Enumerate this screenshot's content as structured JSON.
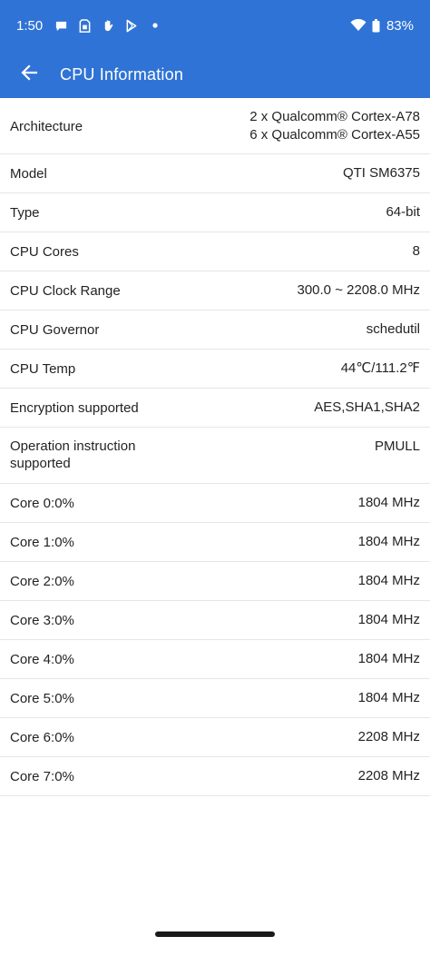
{
  "status_bar": {
    "time": "1:50",
    "battery": "83%",
    "icons": [
      "chat-bubble-icon",
      "sim-card-icon",
      "hand-icon",
      "play-store-icon",
      "dot-icon"
    ]
  },
  "toolbar": {
    "title": "CPU Information",
    "back_icon": "arrow-back-icon"
  },
  "colors": {
    "appbar": "#2f73d6",
    "divider": "#e6e6e6"
  },
  "rows": [
    {
      "label": "Architecture",
      "value_lines": [
        "2 x Qualcomm® Cortex-A78",
        "6 x Qualcomm® Cortex-A55"
      ]
    },
    {
      "label": "Model",
      "value": "QTI SM6375"
    },
    {
      "label": "Type",
      "value": "64-bit"
    },
    {
      "label": "CPU Cores",
      "value": "8"
    },
    {
      "label": "CPU Clock Range",
      "value": "300.0 ~ 2208.0 MHz"
    },
    {
      "label": "CPU Governor",
      "value": "schedutil"
    },
    {
      "label": "CPU Temp",
      "value": "44℃/111.2℉"
    },
    {
      "label": "Encryption supported",
      "value": "AES,SHA1,SHA2"
    },
    {
      "label_lines": [
        "Operation instruction",
        "supported"
      ],
      "value": "PMULL"
    },
    {
      "label": "Core 0:0%",
      "value": "1804 MHz"
    },
    {
      "label": "Core 1:0%",
      "value": "1804 MHz"
    },
    {
      "label": "Core 2:0%",
      "value": "1804 MHz"
    },
    {
      "label": "Core 3:0%",
      "value": "1804 MHz"
    },
    {
      "label": "Core 4:0%",
      "value": "1804 MHz"
    },
    {
      "label": "Core 5:0%",
      "value": "1804 MHz"
    },
    {
      "label": "Core 6:0%",
      "value": "2208 MHz"
    },
    {
      "label": "Core 7:0%",
      "value": "2208 MHz"
    }
  ]
}
